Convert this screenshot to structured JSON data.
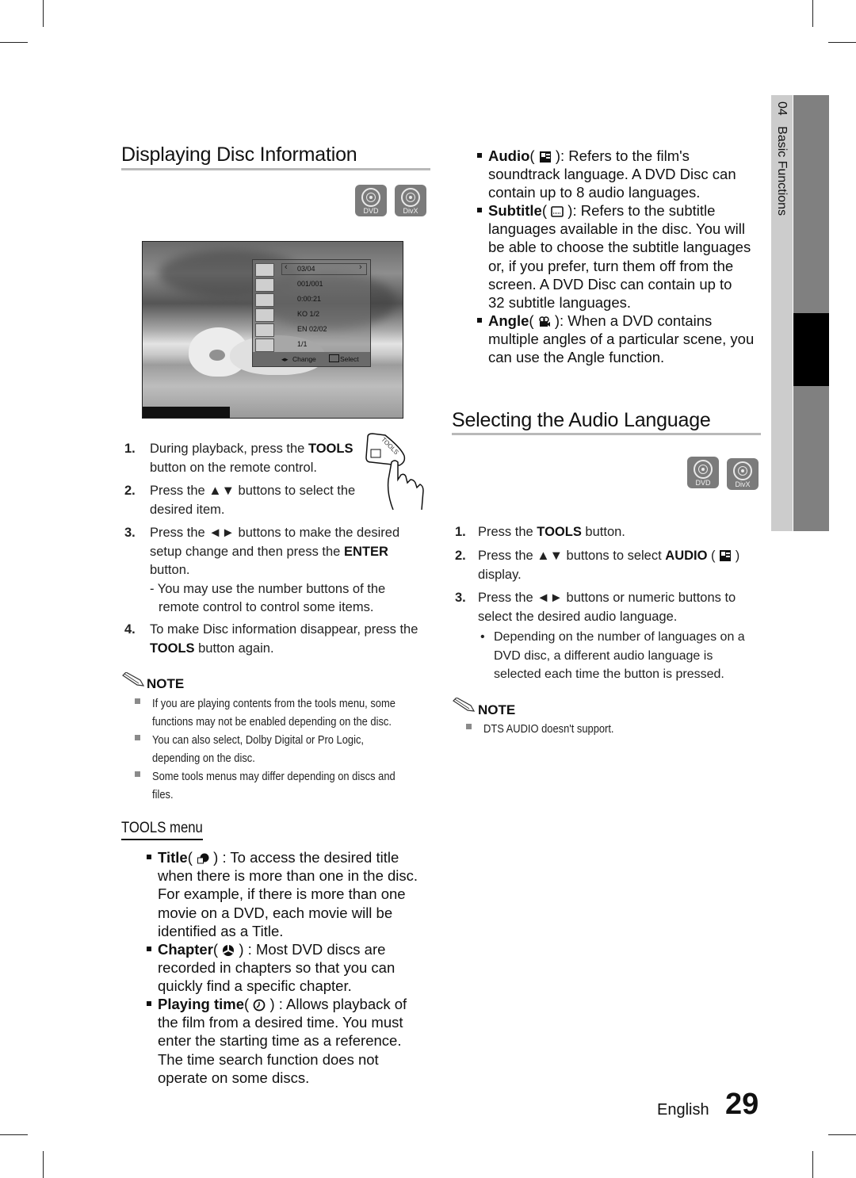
{
  "page": {
    "language": "English",
    "page_number": "29",
    "chapter_tab": {
      "number": "04",
      "title": "Basic Functions"
    }
  },
  "left": {
    "title": "Displaying Disc Information",
    "disc_badges": [
      "DVD",
      "DivX"
    ],
    "osd": {
      "rows": [
        {
          "icon": "title-icon",
          "value": "03/04"
        },
        {
          "icon": "chapter-icon",
          "value": "001/001"
        },
        {
          "icon": "playing-time-icon",
          "value": "0:00:21"
        },
        {
          "icon": "audio-icon",
          "value": "KO 1/2"
        },
        {
          "icon": "subtitle-icon",
          "value": "EN 02/02"
        },
        {
          "icon": "angle-icon",
          "value": "1/1"
        }
      ],
      "footer_change": "Change",
      "footer_select": "Select"
    },
    "remote_button_label": "TOOLS",
    "steps": [
      {
        "num": "1.",
        "pre": "During playback, press the ",
        "bold": "TOOLS",
        "post": "",
        "line2": "button on the remote control."
      },
      {
        "num": "2.",
        "pre": "Press the ▲▼ buttons to select the",
        "bold": "",
        "post": "",
        "line2": "desired item."
      },
      {
        "num": "3.",
        "line1": "Press the ◄► buttons to make the desired",
        "line2_pre": "setup change and then press the ",
        "line2_bold": "ENTER",
        "line3": "button.",
        "sub1": "- You may use the number buttons of the",
        "sub2": "remote control to control some items."
      },
      {
        "num": "4.",
        "line1": "To make Disc information disappear, press the",
        "line2_bold": "TOOLS",
        "line2_post": " button again."
      }
    ],
    "note": {
      "heading": "NOTE",
      "items": [
        [
          "If you are playing contents from the tools menu, some",
          "functions may not be enabled depending on the disc."
        ],
        [
          "You can also select, Dolby Digital or Pro Logic,",
          "depending on the disc."
        ],
        [
          "Some tools menus may differ depending on discs and",
          "files."
        ]
      ]
    },
    "tools_menu": {
      "heading": "TOOLS menu",
      "items": [
        {
          "label": "Title",
          "icon": "title-icon",
          "lines": [
            ") : To access the desired title",
            "when there is more than one in the disc.",
            "For example, if there is more than one",
            "movie on a DVD, each movie will be",
            "identified as a Title."
          ]
        },
        {
          "label": "Chapter",
          "icon": "chapter-icon",
          "lines": [
            ") : Most DVD discs are",
            "recorded in chapters so that you can",
            "quickly find a specific chapter."
          ]
        },
        {
          "label": "Playing time",
          "icon": "playing-time-icon",
          "lines": [
            ") : Allows playback of",
            "the film from a desired time. You must",
            "enter the starting time as a reference.",
            "The time search function does not",
            "operate on some discs."
          ]
        }
      ]
    }
  },
  "right": {
    "bullets": [
      {
        "label": "Audio",
        "icon": "audio-icon",
        "lines": [
          "): Refers to the film's",
          "soundtrack language. A DVD Disc can",
          "contain up to 8 audio languages."
        ]
      },
      {
        "label": "Subtitle",
        "icon": "subtitle-icon",
        "lines": [
          "): Refers to the subtitle",
          "languages available in the disc. You will",
          "be able to choose the subtitle languages",
          "or, if you prefer, turn them off from the",
          "screen. A DVD Disc can contain up to",
          "32 subtitle languages."
        ]
      },
      {
        "label": "Angle",
        "icon": "angle-icon",
        "lines": [
          "): When a DVD contains",
          "multiple angles of a particular scene, you",
          "can use the Angle function."
        ]
      }
    ],
    "title": "Selecting the Audio Language",
    "disc_badges": [
      "DVD",
      "DivX"
    ],
    "steps": [
      {
        "num": "1.",
        "pre": "Press the ",
        "bold": "TOOLS",
        "post": " button."
      },
      {
        "num": "2.",
        "pre": "Press the ▲▼ buttons to select ",
        "bold": "AUDIO",
        "post_open": " (",
        "post_close": " )",
        "line2": "display."
      },
      {
        "num": "3.",
        "line1": "Press the ◄► buttons or numeric buttons to",
        "line2": "select the desired audio language.",
        "bullet": [
          "Depending on the number of languages on a",
          "DVD disc, a different audio language is",
          "selected each time the button is pressed."
        ]
      }
    ],
    "note": {
      "heading": "NOTE",
      "items": [
        [
          "DTS AUDIO doesn't support."
        ]
      ]
    }
  },
  "colors": {
    "tab_light": "#cccccc",
    "tab_dark": "#808080",
    "tab_active": "#000000",
    "rule": "#b9b9b9",
    "badge": "#7b7b7b"
  }
}
